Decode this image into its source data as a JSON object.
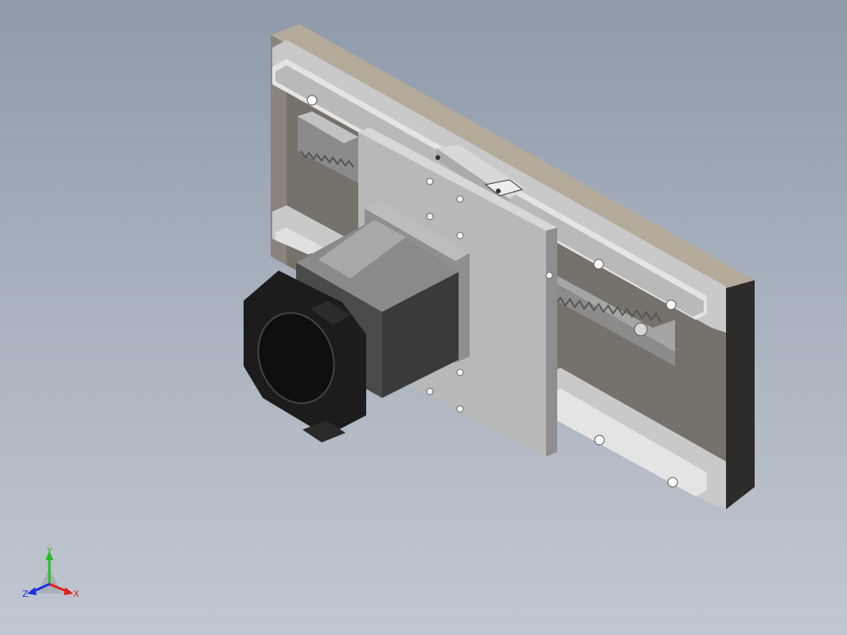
{
  "viewport": {
    "background_top": "#8e9aaa",
    "background_bottom": "#c1c7d0"
  },
  "model": {
    "parts": [
      "base-plate",
      "linear-rail-top",
      "linear-rail-bottom",
      "gear-rack",
      "carriage-plate",
      "stepper-motor",
      "motor-flange",
      "rail-block"
    ]
  },
  "triad": {
    "x_label": "X",
    "y_label": "Y",
    "z_label": "Z",
    "x_color": "#e02020",
    "y_color": "#20c020",
    "z_color": "#2030e0"
  }
}
